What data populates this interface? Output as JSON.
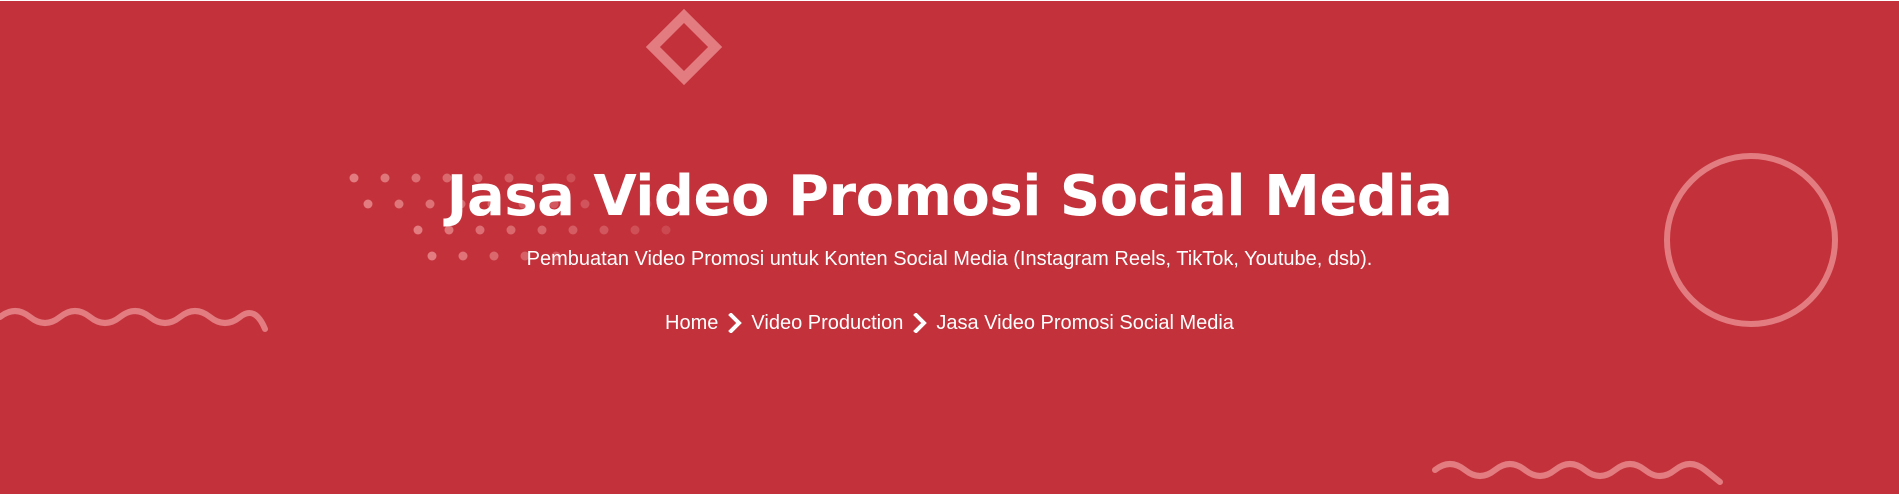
{
  "hero": {
    "title": "Jasa Video Promosi Social Media",
    "subtitle": "Pembuatan Video Promosi untuk Konten Social Media (Instagram Reels, TikTok, Youtube, dsb).",
    "background_color": "#c3313b",
    "decoration_color": "#e27c80"
  },
  "breadcrumb": {
    "items": [
      {
        "label": "Home",
        "icon": "chevron-right-icon"
      },
      {
        "label": "Video Production",
        "icon": "chevron-right-icon"
      },
      {
        "label": "Jasa Video Promosi Social Media"
      }
    ]
  }
}
